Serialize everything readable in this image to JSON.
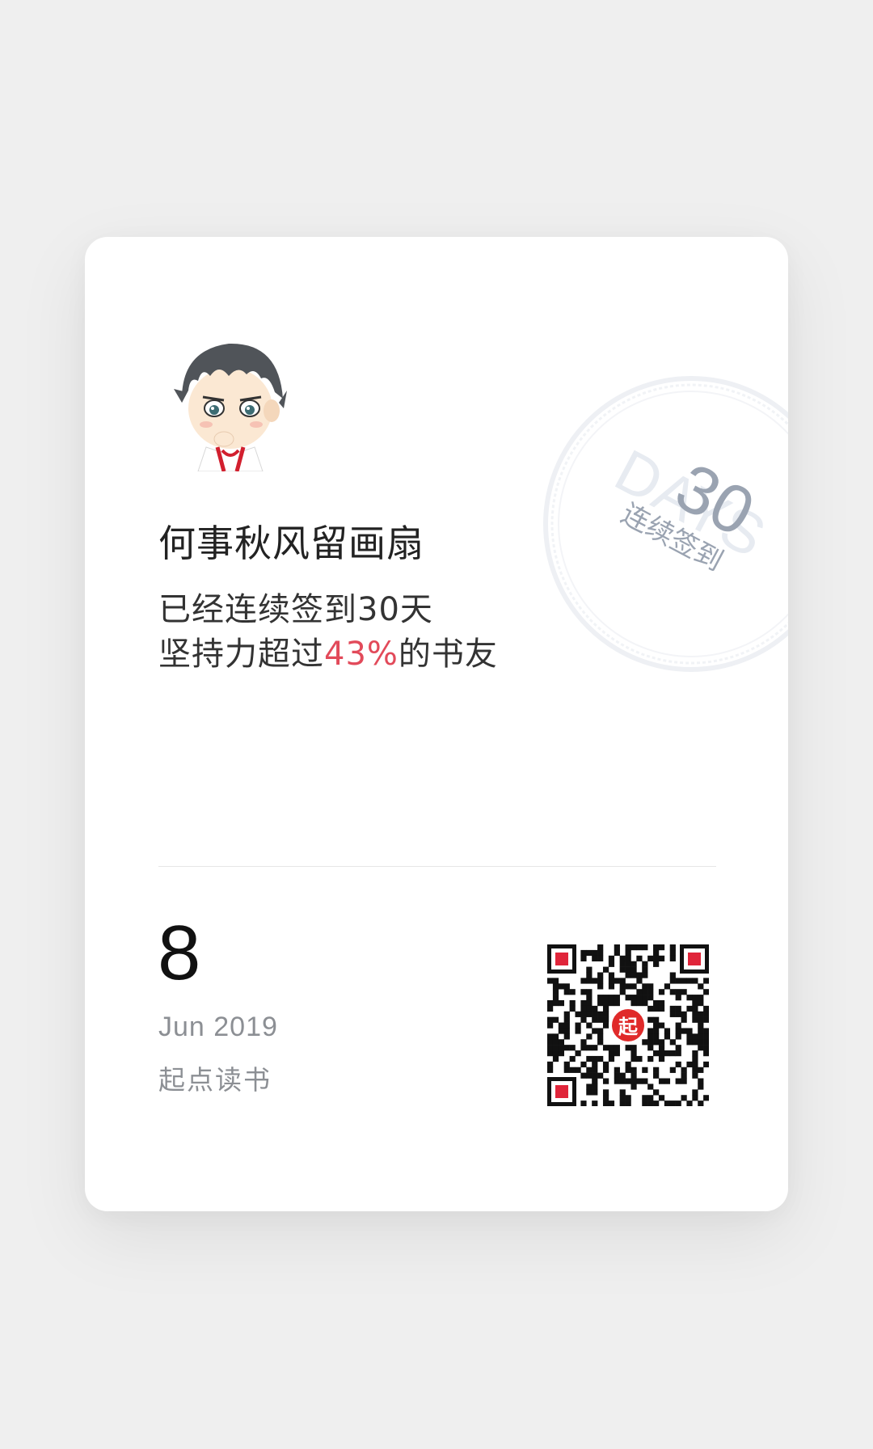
{
  "profile": {
    "username": "何事秋风留画扇",
    "avatar_icon": "anime-boy-avatar-icon"
  },
  "checkin": {
    "line1": "已经连续签到30天",
    "line2_prefix": "坚持力超过",
    "line2_percent": "43%",
    "line2_suffix": "的书友",
    "percent_color": "#e24a5a"
  },
  "stamp": {
    "number": "30",
    "word": "DAYS",
    "label": "连续签到"
  },
  "date": {
    "day": "8",
    "month_year": "Jun 2019"
  },
  "brand": {
    "name": "起点读书",
    "qr_icon": "qr-code-icon",
    "qr_badge": "起",
    "badge_color": "#e02a2a"
  }
}
